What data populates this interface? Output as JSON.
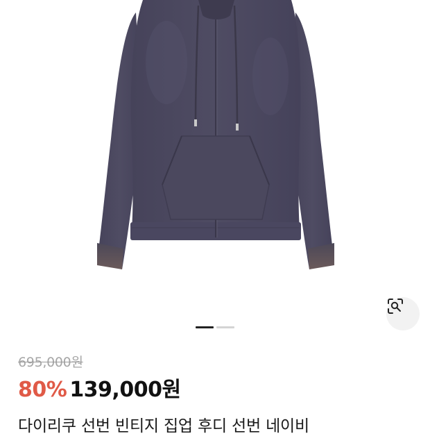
{
  "product": {
    "original_price": "695,000원",
    "discount": "80%",
    "sale_price": "139,000원",
    "title": "다이리쿠 선번 빈티지 집업 후디 선번 네이비",
    "colors": {
      "discount": "#e05a47",
      "garment": "#4e4a5e"
    }
  },
  "gallery": {
    "total_slides": 2,
    "active_slide": 1,
    "lens_icon": "lens-search-icon"
  }
}
